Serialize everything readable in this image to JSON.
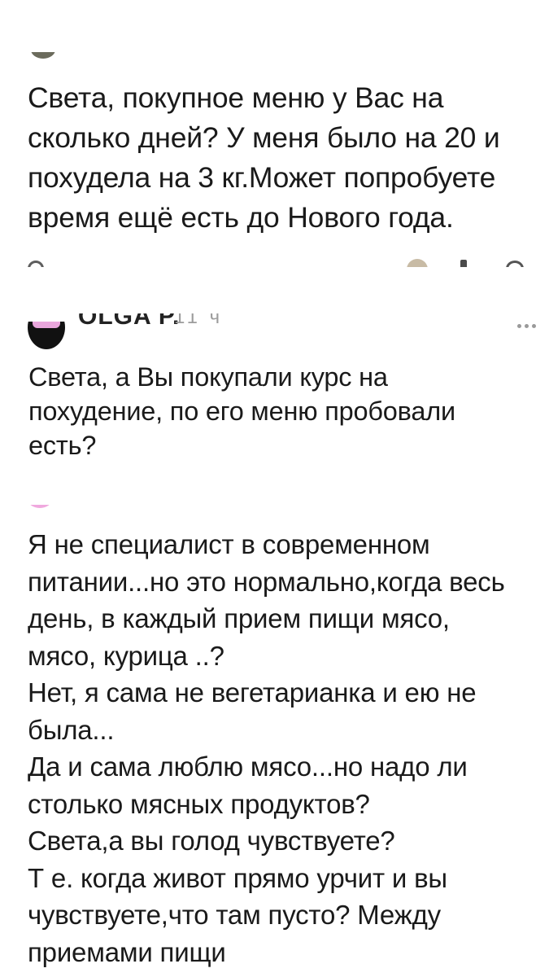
{
  "comments": [
    {
      "avatar": "user-avatar-partial",
      "text_lines": [
        "Света, покупное меню у Вас на",
        "сколько дней? У меня было на 20 и",
        "похудела на 3 кг.Может попробуете",
        "время ещё есть до Нового года."
      ],
      "actions": [
        "reply-icon",
        "reaction-avatar",
        "like-icon",
        "comment-count-icon"
      ]
    },
    {
      "author": "OLGA P.",
      "time": "11 ч",
      "menu_icon": "more-icon",
      "text_lines": [
        "Света, а Вы покупали курс на",
        "похудение, по его меню пробовали",
        "есть?"
      ]
    },
    {
      "avatar": "user-avatar-partial",
      "text_lines": [
        "Я не специалист в современном",
        "питании...но это нормально,когда весь",
        "день, в каждый прием пищи мясо,",
        "мясо, курица ..?",
        "Нет, я сама не вегетарианка и ею не",
        "была...",
        "Да и сама люблю мясо...но надо ли",
        "столько мясных продуктов?",
        "Света,а вы голод чувствуете?",
        "Т е. когда живот прямо урчит и вы",
        "чувствуете,что там пусто? Между",
        "приемами пищи"
      ]
    }
  ],
  "colors": {
    "text": "#1a1a1a",
    "meta": "#9c9c9c",
    "avatar_pink": "#e9a6dc"
  }
}
